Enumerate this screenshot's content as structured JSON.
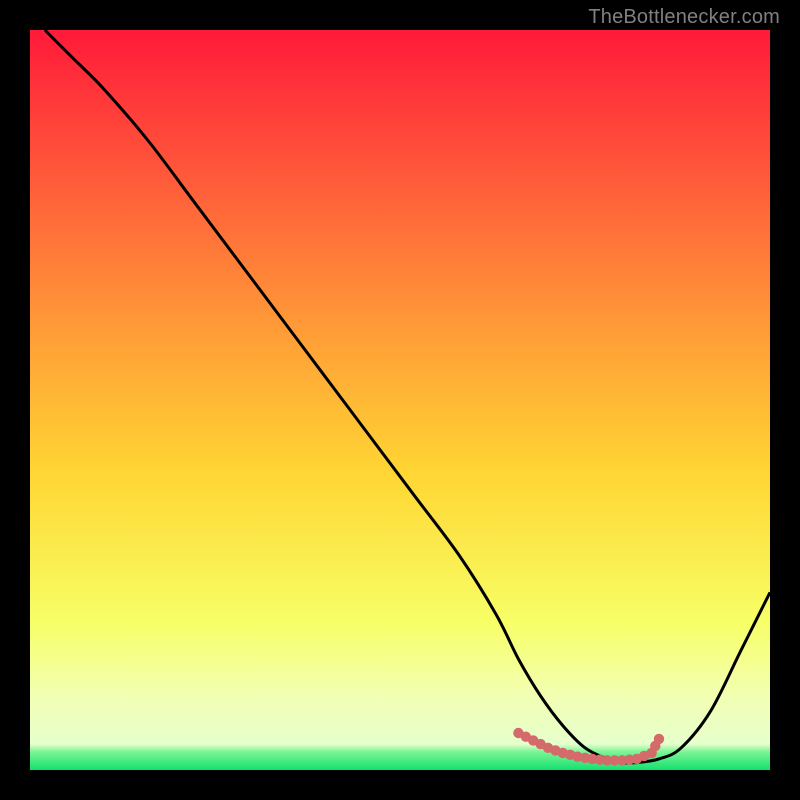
{
  "attribution": "TheBottlenecker.com",
  "colors": {
    "bg": "#000000",
    "text": "#808080",
    "curve": "#000000",
    "dots": "#d46a6a",
    "grad_top": "#ff1a3a",
    "grad_upper": "#ff6a3a",
    "grad_mid": "#ffd633",
    "grad_low": "#f7ff66",
    "grad_pale": "#f2ffb3",
    "grad_bottom": "#13e06e"
  },
  "chart_data": {
    "type": "line",
    "title": "",
    "xlabel": "",
    "ylabel": "",
    "xlim": [
      0,
      100
    ],
    "ylim": [
      0,
      100
    ],
    "series": [
      {
        "name": "bottleneck-curve",
        "x": [
          2,
          6,
          10,
          16,
          22,
          28,
          34,
          40,
          46,
          52,
          58,
          63,
          66,
          69,
          72,
          75,
          78,
          80,
          82,
          85,
          88,
          92,
          96,
          100
        ],
        "y": [
          100,
          96,
          92,
          85,
          77,
          69,
          61,
          53,
          45,
          37,
          29,
          21,
          15,
          10,
          6,
          3,
          1.5,
          1,
          1,
          1.5,
          3,
          8,
          16,
          24
        ]
      },
      {
        "name": "optimal-points",
        "x": [
          66,
          68,
          70,
          72,
          74,
          76,
          78,
          80,
          82,
          84,
          85
        ],
        "y": [
          5,
          4,
          3,
          2.3,
          1.8,
          1.5,
          1.3,
          1.3,
          1.5,
          2.3,
          4.2
        ]
      }
    ],
    "gradient_stops": [
      {
        "offset": 0.0,
        "color": "#ff1a3a"
      },
      {
        "offset": 0.2,
        "color": "#ff5a3a"
      },
      {
        "offset": 0.42,
        "color": "#ffa037"
      },
      {
        "offset": 0.6,
        "color": "#ffd633"
      },
      {
        "offset": 0.8,
        "color": "#f7ff66"
      },
      {
        "offset": 0.9,
        "color": "#f2ffb3"
      },
      {
        "offset": 0.965,
        "color": "#e6ffcc"
      },
      {
        "offset": 0.975,
        "color": "#7ef596"
      },
      {
        "offset": 1.0,
        "color": "#13e06e"
      }
    ]
  }
}
